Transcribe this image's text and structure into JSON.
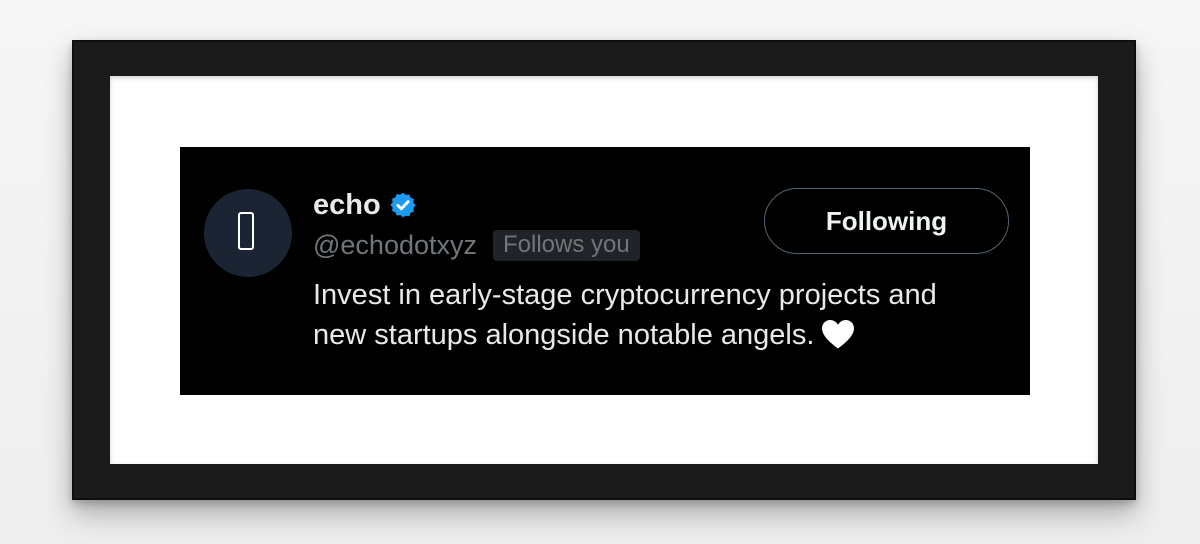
{
  "profile": {
    "display_name": "echo",
    "verified": true,
    "handle": "@echodotxyz",
    "follows_you_label": "Follows you",
    "bio": "Invest in early-stage cryptocurrency projects and new startups alongside notable angels.",
    "avatar_icon": "phone-icon",
    "bio_emoji_icon": "white-heart-icon"
  },
  "actions": {
    "follow_button_label": "Following"
  },
  "colors": {
    "card_background": "#000000",
    "verified_badge": "#1d9bf0",
    "primary_text": "#e7e9ea",
    "secondary_text": "#71767b",
    "frame": "#1b1b1b",
    "mat": "#ffffff"
  }
}
